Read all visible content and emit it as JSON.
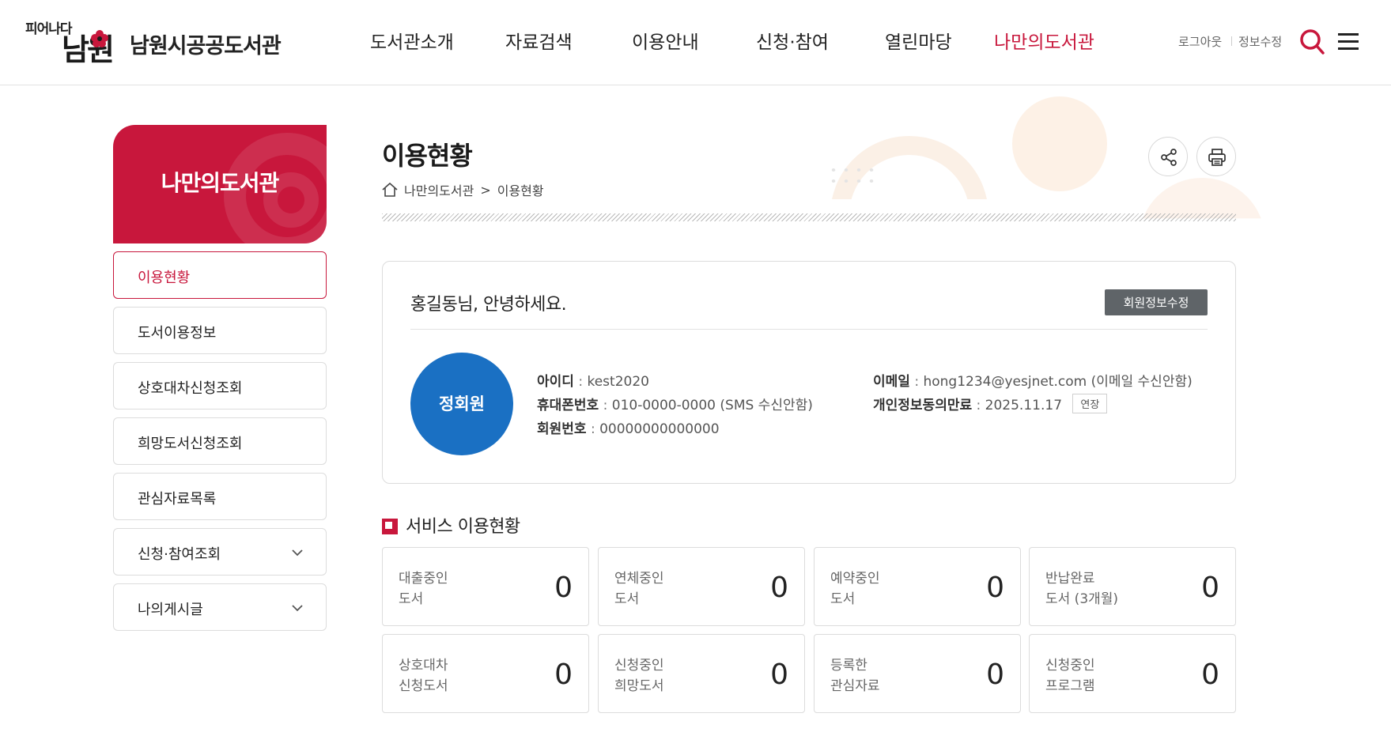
{
  "header": {
    "logo_slogan": "피어나다",
    "logo_mark": "남원",
    "library_name": "남원시공공도서관",
    "nav": [
      {
        "label": "도서관소개"
      },
      {
        "label": "자료검색"
      },
      {
        "label": "이용안내"
      },
      {
        "label": "신청·참여"
      },
      {
        "label": "열린마당"
      },
      {
        "label": "나만의도서관",
        "active": true
      }
    ],
    "logout_label": "로그아웃",
    "profile_edit_label": "정보수정",
    "accent_color": "#c8173c"
  },
  "sidebar": {
    "title": "나만의도서관",
    "items": [
      {
        "label": "이용현황",
        "active": true
      },
      {
        "label": "도서이용정보"
      },
      {
        "label": "상호대차신청조회"
      },
      {
        "label": "희망도서신청조회"
      },
      {
        "label": "관심자료목록"
      },
      {
        "label": "신청·참여조회",
        "expandable": true
      },
      {
        "label": "나의게시글",
        "expandable": true
      }
    ]
  },
  "main": {
    "page_title": "이용현황",
    "breadcrumb": [
      "나만의도서관",
      "이용현황"
    ],
    "breadcrumb_sep": ">"
  },
  "member": {
    "greeting": "홍길동님, 안녕하세요.",
    "edit_button": "회원정보수정",
    "grade": "정회원",
    "grade_color": "#1a70c3",
    "id_label": "아이디",
    "id_value": "kest2020",
    "phone_label": "휴대폰번호",
    "phone_value": "010-0000-0000 (SMS 수신안함)",
    "member_no_label": "회원번호",
    "member_no_value": "00000000000000",
    "email_label": "이메일",
    "email_value": "hong1234@yesjnet.com (이메일 수신안함)",
    "privacy_label": "개인정보동의만료",
    "privacy_value": "2025.11.17",
    "extend_button": "연장",
    "separator": ":"
  },
  "service": {
    "title": "서비스 이용현황",
    "cards": [
      {
        "line1": "대출중인",
        "line2": "도서",
        "count": "0"
      },
      {
        "line1": "연체중인",
        "line2": "도서",
        "count": "0"
      },
      {
        "line1": "예약중인",
        "line2": "도서",
        "count": "0"
      },
      {
        "line1": "반납완료",
        "line2": "도서 (3개월)",
        "count": "0"
      },
      {
        "line1": "상호대차",
        "line2": "신청도서",
        "count": "0"
      },
      {
        "line1": "신청중인",
        "line2": "희망도서",
        "count": "0"
      },
      {
        "line1": "등록한",
        "line2": "관심자료",
        "count": "0"
      },
      {
        "line1": "신청중인",
        "line2": "프로그램",
        "count": "0"
      }
    ]
  }
}
